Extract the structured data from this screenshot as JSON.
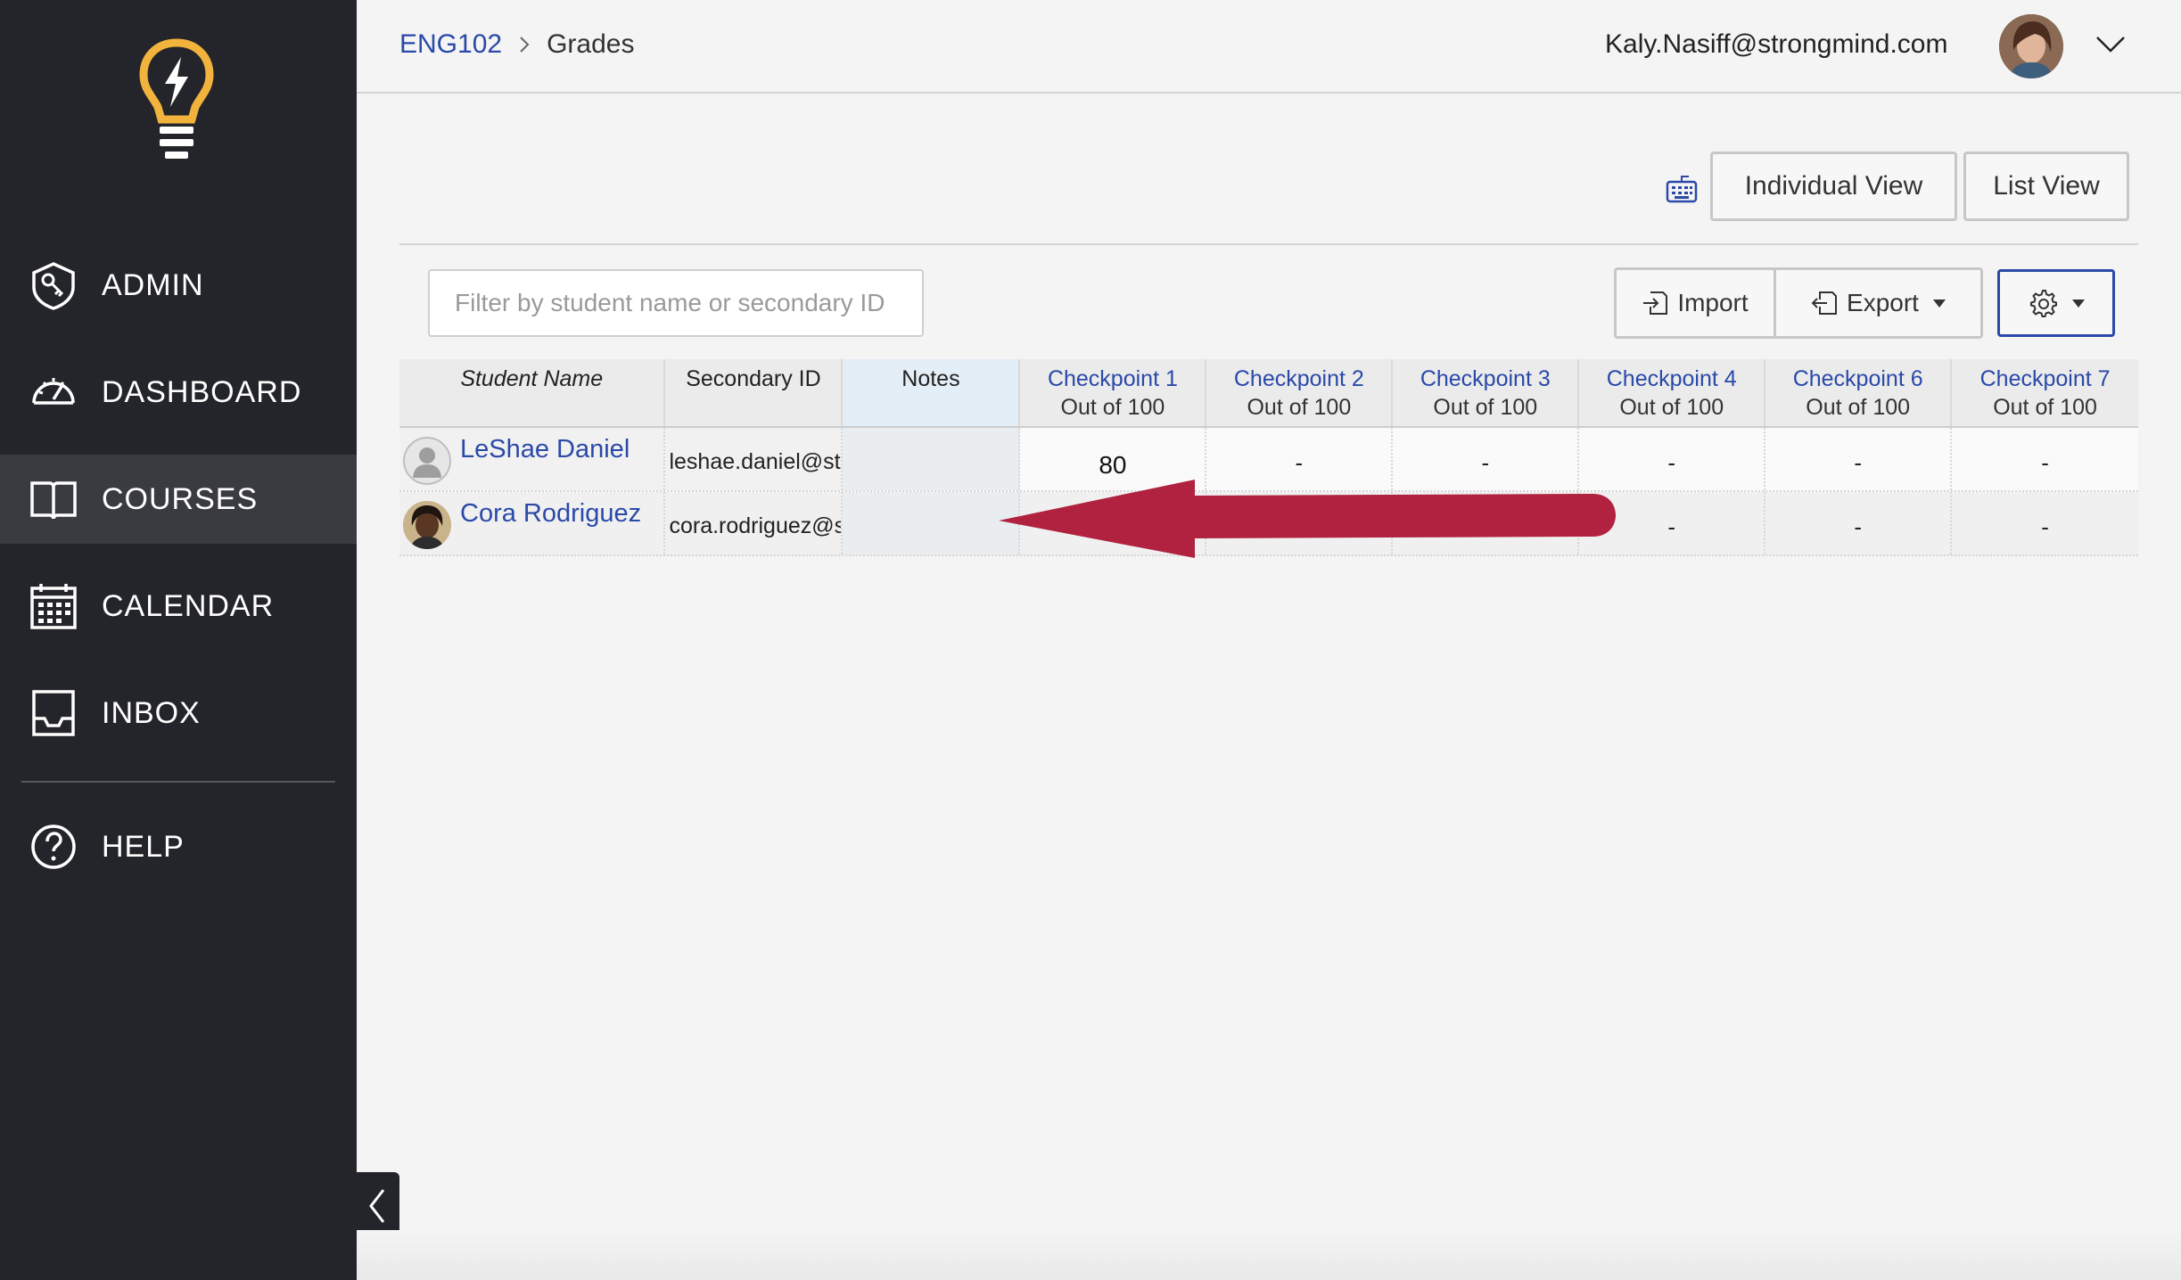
{
  "sidebar": {
    "items": [
      {
        "label": "ADMIN",
        "icon": "shield-key-icon"
      },
      {
        "label": "DASHBOARD",
        "icon": "speedometer-icon"
      },
      {
        "label": "COURSES",
        "icon": "book-icon",
        "active": true
      },
      {
        "label": "CALENDAR",
        "icon": "calendar-icon"
      },
      {
        "label": "INBOX",
        "icon": "inbox-tray-icon"
      },
      {
        "label": "HELP",
        "icon": "help-circle-icon"
      }
    ]
  },
  "header": {
    "breadcrumb": {
      "course": "ENG102",
      "current": "Grades"
    },
    "user_email": "Kaly.Nasiff@strongmind.com"
  },
  "toolbar": {
    "individual_view": "Individual View",
    "list_view": "List View",
    "filter_placeholder": "Filter by student name or secondary ID",
    "import_label": "Import",
    "export_label": "Export"
  },
  "table": {
    "headers": {
      "student_name": "Student Name",
      "secondary_id": "Secondary ID",
      "notes": "Notes"
    },
    "checkpoints": [
      {
        "title": "Checkpoint 1",
        "sub": "Out of 100"
      },
      {
        "title": "Checkpoint 2",
        "sub": "Out of 100"
      },
      {
        "title": "Checkpoint 3",
        "sub": "Out of 100"
      },
      {
        "title": "Checkpoint 4",
        "sub": "Out of 100"
      },
      {
        "title": "Checkpoint 6",
        "sub": "Out of 100"
      },
      {
        "title": "Checkpoint 7",
        "sub": "Out of 100"
      }
    ],
    "rows": [
      {
        "name": "LeShae Daniel",
        "secondary_id": "leshae.daniel@strongmind.com",
        "grades": [
          "80",
          "-",
          "-",
          "-",
          "-",
          "-"
        ]
      },
      {
        "name": "Cora Rodriguez",
        "secondary_id": "cora.rodriguez@strongmind.com",
        "grades": [
          "",
          "",
          "",
          "-",
          "-",
          "-"
        ]
      }
    ]
  },
  "colors": {
    "sidebar_bg": "#23252a",
    "sidebar_active": "#393b41",
    "accent_link": "#2a49a8",
    "logo_yellow": "#f2b33d",
    "annotation_arrow": "#b0223f"
  }
}
